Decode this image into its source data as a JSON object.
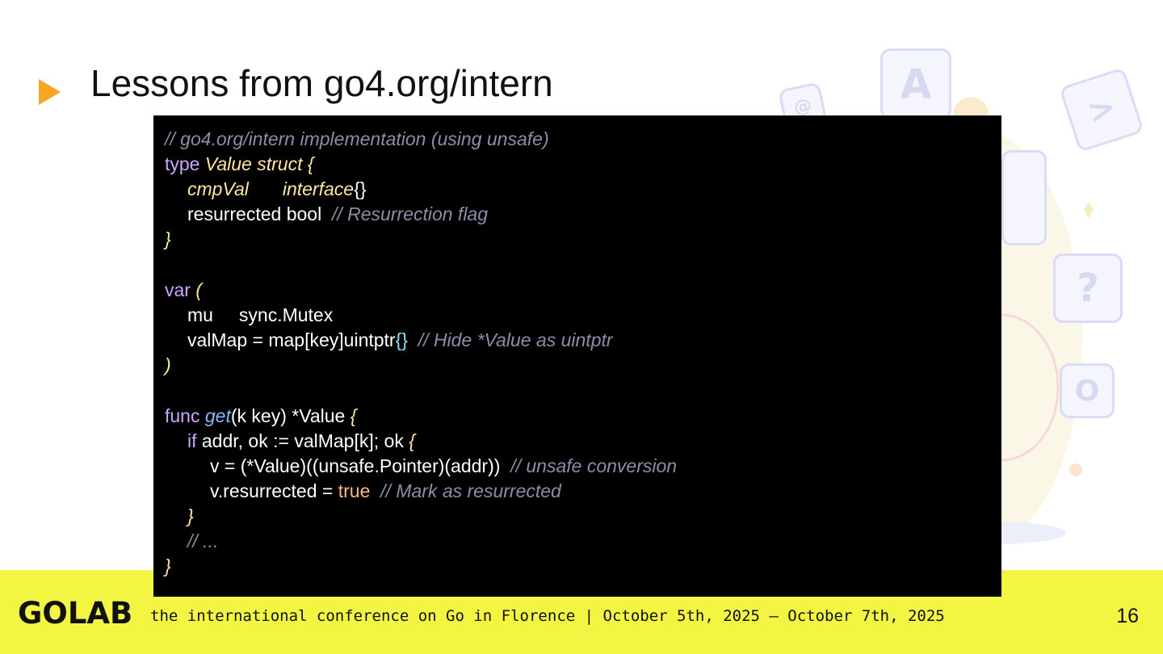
{
  "slide": {
    "title": "Lessons from go4.org/intern",
    "page_number": "16"
  },
  "code": {
    "l1": "// go4.org/intern implementation (using unsafe)",
    "l2_kw": "type",
    "l2_name": "Value",
    "l2_struct": "struct",
    "l2_brace": "{",
    "l3_field": "cmpVal",
    "l3_type": "interface",
    "l3_braces": "{}",
    "l4_field": "resurrected bool",
    "l4_comment": "// Resurrection flag",
    "l5": "}",
    "l7_kw": "var",
    "l7_paren": "(",
    "l8": "mu     sync.Mutex",
    "l9_code": "valMap = map[key]uintptr",
    "l9_braces": "{}",
    "l9_comment": "// Hide *Value as uintptr",
    "l10": ")",
    "l12_kw": "func",
    "l12_fn": "get",
    "l12_rest": "(k key) *Value",
    "l12_brace": "{",
    "l13_kw": "if",
    "l13_rest": "addr, ok := valMap[k]; ok",
    "l13_brace": "{",
    "l14_code": "v = (*Value)((unsafe.Pointer)(addr))",
    "l14_comment": "// unsafe conversion",
    "l15_code": "v.resurrected = ",
    "l15_bool": "true",
    "l15_comment": "// Mark as resurrected",
    "l16": "}",
    "l17": "// ...",
    "l18": "}"
  },
  "footer": {
    "logo": "GOLAB",
    "tagline": "the international conference on Go in Florence | October 5th, 2025 – October 7th, 2025"
  },
  "decoration": {
    "keys": [
      "A",
      "?",
      "O",
      "@",
      ">"
    ]
  },
  "colors": {
    "footer_bg": "#f2f542",
    "title_arrow": "#f5a623",
    "code_bg": "#000000"
  }
}
